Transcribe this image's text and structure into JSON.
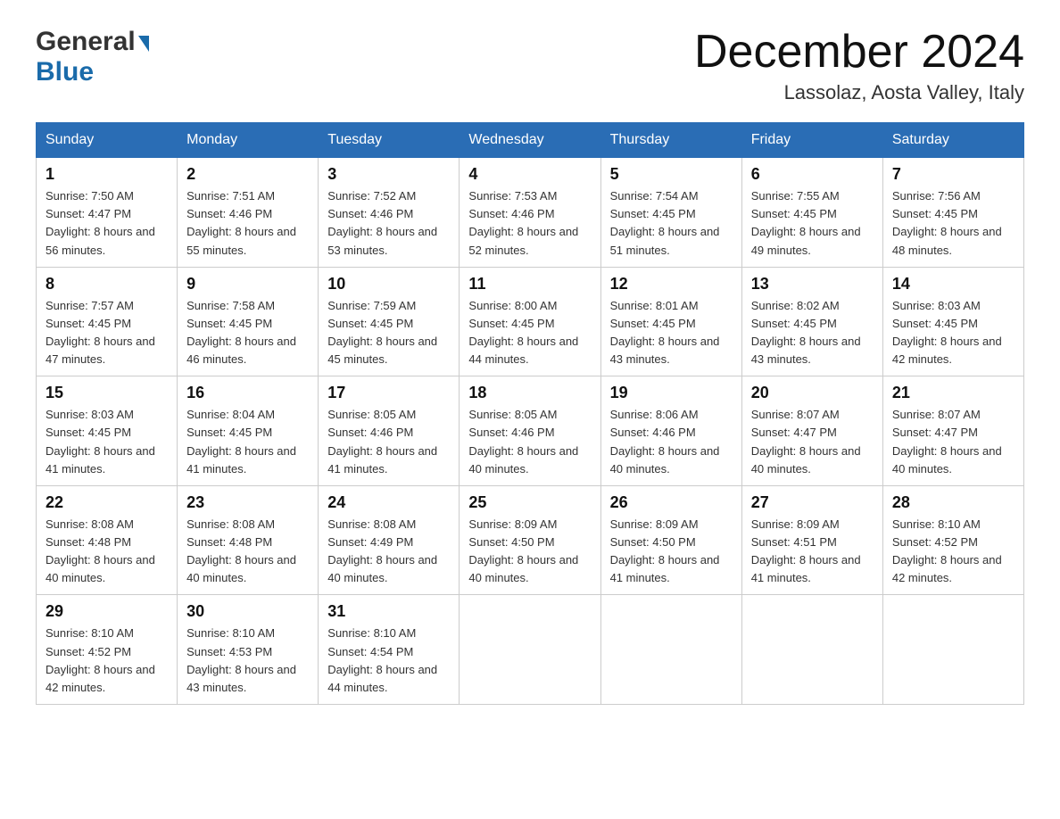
{
  "logo": {
    "general": "General",
    "blue": "Blue",
    "triangle_char": "▶"
  },
  "title": {
    "month": "December 2024",
    "location": "Lassolaz, Aosta Valley, Italy"
  },
  "headers": [
    "Sunday",
    "Monday",
    "Tuesday",
    "Wednesday",
    "Thursday",
    "Friday",
    "Saturday"
  ],
  "weeks": [
    [
      {
        "day": "1",
        "sunrise": "7:50 AM",
        "sunset": "4:47 PM",
        "daylight": "8 hours and 56 minutes."
      },
      {
        "day": "2",
        "sunrise": "7:51 AM",
        "sunset": "4:46 PM",
        "daylight": "8 hours and 55 minutes."
      },
      {
        "day": "3",
        "sunrise": "7:52 AM",
        "sunset": "4:46 PM",
        "daylight": "8 hours and 53 minutes."
      },
      {
        "day": "4",
        "sunrise": "7:53 AM",
        "sunset": "4:46 PM",
        "daylight": "8 hours and 52 minutes."
      },
      {
        "day": "5",
        "sunrise": "7:54 AM",
        "sunset": "4:45 PM",
        "daylight": "8 hours and 51 minutes."
      },
      {
        "day": "6",
        "sunrise": "7:55 AM",
        "sunset": "4:45 PM",
        "daylight": "8 hours and 49 minutes."
      },
      {
        "day": "7",
        "sunrise": "7:56 AM",
        "sunset": "4:45 PM",
        "daylight": "8 hours and 48 minutes."
      }
    ],
    [
      {
        "day": "8",
        "sunrise": "7:57 AM",
        "sunset": "4:45 PM",
        "daylight": "8 hours and 47 minutes."
      },
      {
        "day": "9",
        "sunrise": "7:58 AM",
        "sunset": "4:45 PM",
        "daylight": "8 hours and 46 minutes."
      },
      {
        "day": "10",
        "sunrise": "7:59 AM",
        "sunset": "4:45 PM",
        "daylight": "8 hours and 45 minutes."
      },
      {
        "day": "11",
        "sunrise": "8:00 AM",
        "sunset": "4:45 PM",
        "daylight": "8 hours and 44 minutes."
      },
      {
        "day": "12",
        "sunrise": "8:01 AM",
        "sunset": "4:45 PM",
        "daylight": "8 hours and 43 minutes."
      },
      {
        "day": "13",
        "sunrise": "8:02 AM",
        "sunset": "4:45 PM",
        "daylight": "8 hours and 43 minutes."
      },
      {
        "day": "14",
        "sunrise": "8:03 AM",
        "sunset": "4:45 PM",
        "daylight": "8 hours and 42 minutes."
      }
    ],
    [
      {
        "day": "15",
        "sunrise": "8:03 AM",
        "sunset": "4:45 PM",
        "daylight": "8 hours and 41 minutes."
      },
      {
        "day": "16",
        "sunrise": "8:04 AM",
        "sunset": "4:45 PM",
        "daylight": "8 hours and 41 minutes."
      },
      {
        "day": "17",
        "sunrise": "8:05 AM",
        "sunset": "4:46 PM",
        "daylight": "8 hours and 41 minutes."
      },
      {
        "day": "18",
        "sunrise": "8:05 AM",
        "sunset": "4:46 PM",
        "daylight": "8 hours and 40 minutes."
      },
      {
        "day": "19",
        "sunrise": "8:06 AM",
        "sunset": "4:46 PM",
        "daylight": "8 hours and 40 minutes."
      },
      {
        "day": "20",
        "sunrise": "8:07 AM",
        "sunset": "4:47 PM",
        "daylight": "8 hours and 40 minutes."
      },
      {
        "day": "21",
        "sunrise": "8:07 AM",
        "sunset": "4:47 PM",
        "daylight": "8 hours and 40 minutes."
      }
    ],
    [
      {
        "day": "22",
        "sunrise": "8:08 AM",
        "sunset": "4:48 PM",
        "daylight": "8 hours and 40 minutes."
      },
      {
        "day": "23",
        "sunrise": "8:08 AM",
        "sunset": "4:48 PM",
        "daylight": "8 hours and 40 minutes."
      },
      {
        "day": "24",
        "sunrise": "8:08 AM",
        "sunset": "4:49 PM",
        "daylight": "8 hours and 40 minutes."
      },
      {
        "day": "25",
        "sunrise": "8:09 AM",
        "sunset": "4:50 PM",
        "daylight": "8 hours and 40 minutes."
      },
      {
        "day": "26",
        "sunrise": "8:09 AM",
        "sunset": "4:50 PM",
        "daylight": "8 hours and 41 minutes."
      },
      {
        "day": "27",
        "sunrise": "8:09 AM",
        "sunset": "4:51 PM",
        "daylight": "8 hours and 41 minutes."
      },
      {
        "day": "28",
        "sunrise": "8:10 AM",
        "sunset": "4:52 PM",
        "daylight": "8 hours and 42 minutes."
      }
    ],
    [
      {
        "day": "29",
        "sunrise": "8:10 AM",
        "sunset": "4:52 PM",
        "daylight": "8 hours and 42 minutes."
      },
      {
        "day": "30",
        "sunrise": "8:10 AM",
        "sunset": "4:53 PM",
        "daylight": "8 hours and 43 minutes."
      },
      {
        "day": "31",
        "sunrise": "8:10 AM",
        "sunset": "4:54 PM",
        "daylight": "8 hours and 44 minutes."
      },
      null,
      null,
      null,
      null
    ]
  ]
}
